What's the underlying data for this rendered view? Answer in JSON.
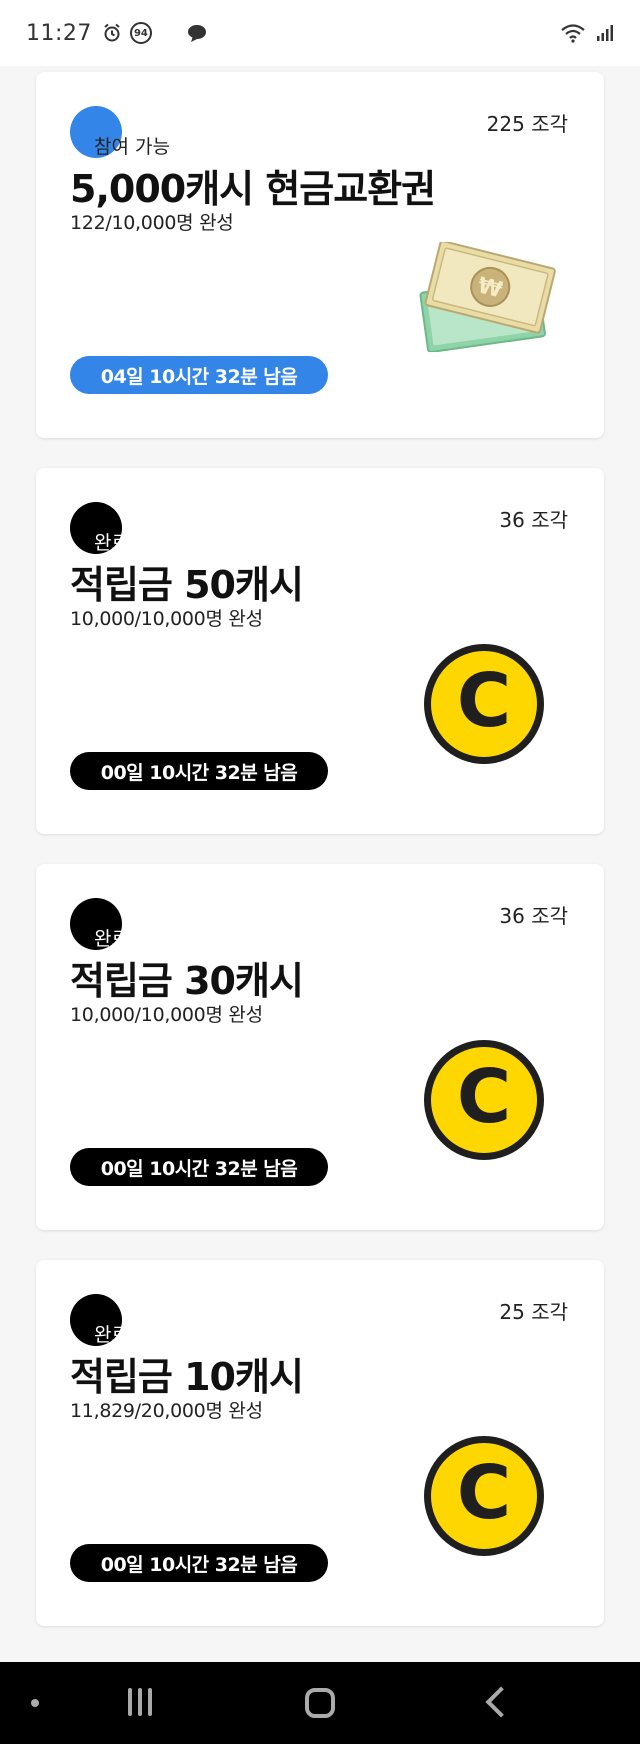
{
  "status_bar": {
    "time": "11:27",
    "notification_badge": "94"
  },
  "colors": {
    "accent_blue": "#3485e8",
    "done_black": "#000000",
    "coin_yellow": "#ffd700"
  },
  "cards": [
    {
      "pieces": "225 조각",
      "status": "참여 가능",
      "status_color": "#3485e8",
      "title": "5,000캐시 현금교환권",
      "progress": "122/10,000명 완성",
      "timer": "04일 10시간 32분 남음",
      "timer_color": "#3485e8",
      "icon": "cash-bill-icon"
    },
    {
      "pieces": "36 조각",
      "status": "완료",
      "status_color": "#000000",
      "title": "적립금 50캐시",
      "progress": "10,000/10,000명 완성",
      "timer": "00일 10시간 32분 남음",
      "timer_color": "#000000",
      "icon": "coin-icon",
      "coin_letter": "C"
    },
    {
      "pieces": "36 조각",
      "status": "완료",
      "status_color": "#000000",
      "title": "적립금 30캐시",
      "progress": "10,000/10,000명 완성",
      "timer": "00일 10시간 32분 남음",
      "timer_color": "#000000",
      "icon": "coin-icon",
      "coin_letter": "C"
    },
    {
      "pieces": "25 조각",
      "status": "완료",
      "status_color": "#000000",
      "title": "적립금 10캐시",
      "progress": "11,829/20,000명 완성",
      "timer": "00일 10시간 32분 남음",
      "timer_color": "#000000",
      "icon": "coin-icon",
      "coin_letter": "C"
    }
  ],
  "nav_bar": {
    "items": [
      "dot-icon",
      "recent-apps-icon",
      "home-icon",
      "back-icon"
    ]
  }
}
